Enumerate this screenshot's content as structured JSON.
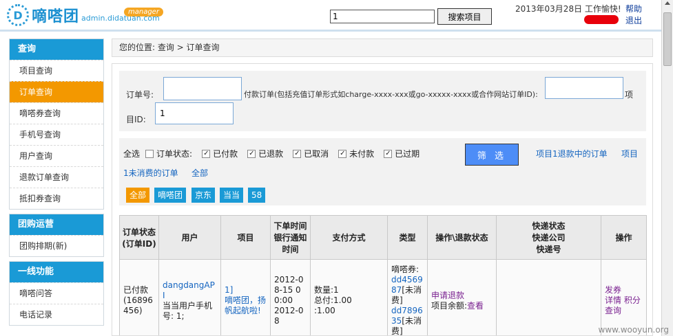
{
  "header": {
    "logo_mark": "D",
    "logo_name": "嘀嗒团",
    "logo_url": "admin.didatuan.com",
    "manager_badge": "manager",
    "search_value": "1",
    "search_button": "搜索项目",
    "date_text": "2013年03月28日 工作愉快!",
    "help": "帮助",
    "logout": "退出"
  },
  "sidebar": {
    "groups": [
      {
        "heading": "查询",
        "items": [
          "项目查询",
          "订单查询",
          "嘀嗒券查询",
          "手机号查询",
          "用户查询",
          "退款订单查询",
          "抵扣券查询"
        ]
      },
      {
        "heading": "团购运营",
        "items": [
          "团购排期(新)"
        ]
      },
      {
        "heading": "一线功能",
        "items": [
          "嘀嗒问答",
          "电话记录"
        ]
      }
    ]
  },
  "breadcrumb": "您的位置: 查询 > 订单查询",
  "filter": {
    "order_no_label": "订单号:",
    "pay_order_label": "付款订单(包括充值订单形式如charge-xxxx-xxx或go-xxxxx-xxxx或合作网站订单ID):",
    "project_label": "项",
    "project_label2": "目ID:",
    "project_value": "1"
  },
  "status": {
    "select_all": "全选",
    "options": [
      {
        "label": "订单状态:",
        "checked": false
      },
      {
        "label": "已付款",
        "checked": true
      },
      {
        "label": "已退款",
        "checked": true
      },
      {
        "label": "已取消",
        "checked": true
      },
      {
        "label": "未付款",
        "checked": true
      },
      {
        "label": "已过期",
        "checked": true
      }
    ],
    "filter_button": "筛 选",
    "link1": "项目1退款中的订单",
    "link2": "项目",
    "link3": "1未消费的订单",
    "link4": "全部"
  },
  "sources": [
    "全部",
    "嘀嗒团",
    "京东",
    "当当",
    "58"
  ],
  "table": {
    "headers": [
      "订单状态\n(订单ID)",
      "用户",
      "项目",
      "下单时间\n银行通知\n时间",
      "支付方式",
      "类型",
      "操作\\退款状态",
      "快递状态\n快递公司\n快递号",
      "操作"
    ],
    "row": {
      "status": "已付款\n(16896456)",
      "user_link": "dangdangAPI",
      "user_text": "当当用户手机号: 1;",
      "project_link": "1]\n嘀嗒团，扬帆起航啦!",
      "time": "2012-08-15 00:00\n2012-08",
      "payment": "数量:1\n总付:1.00\n:1.00",
      "type_label": "嘀嗒券:",
      "type_code1": "dd456987",
      "type_note1": "[未消费]",
      "type_code2": "dd789635",
      "type_note2": "[未消费]",
      "refund_link": "申请退款",
      "balance_label": "项目余额:",
      "balance_link": "查看",
      "express": "",
      "op1": "发券",
      "op2": "详情",
      "op3": "积分",
      "op4": "查询"
    }
  },
  "watermark": "www.wooyun.org"
}
